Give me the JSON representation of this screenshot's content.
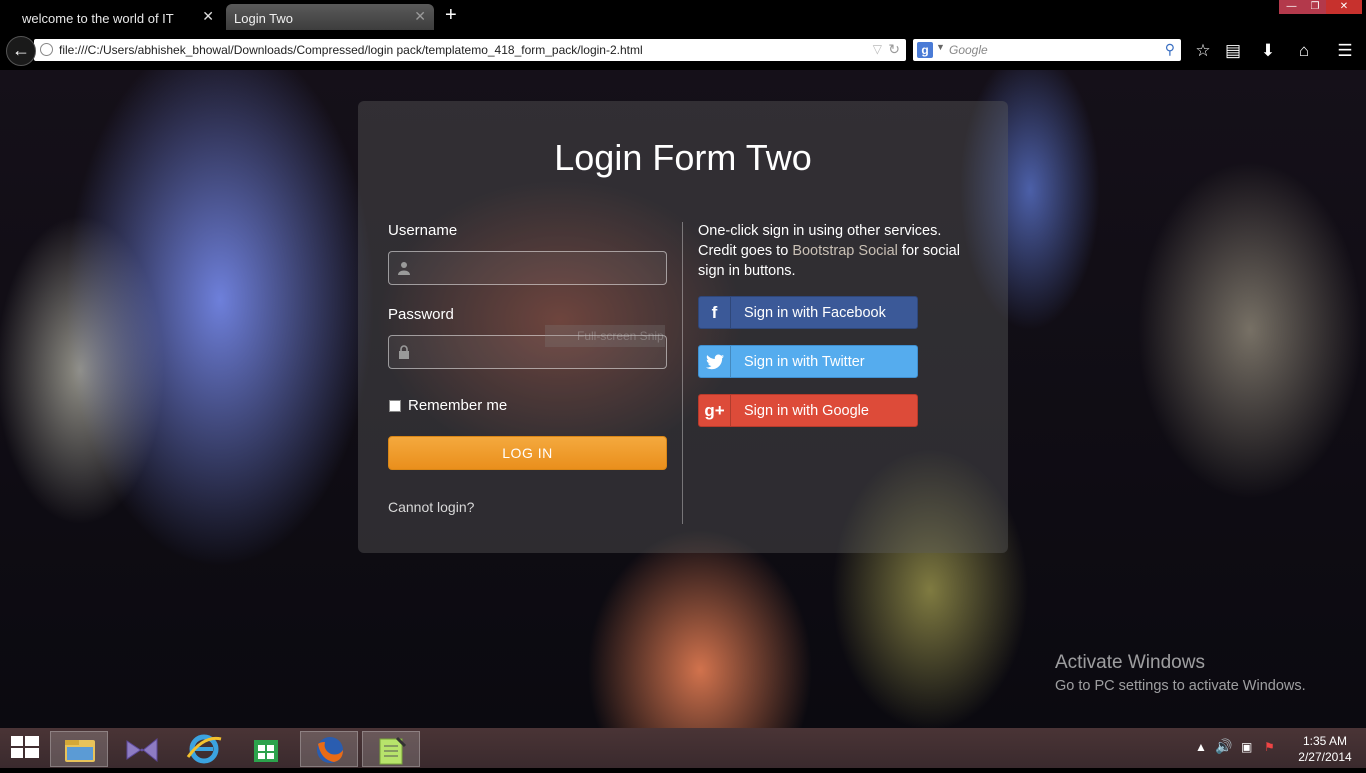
{
  "browser": {
    "tabs": [
      {
        "label": "welcome to the world of IT",
        "active": false
      },
      {
        "label": "Login Two",
        "active": true
      }
    ],
    "address": "file:///C:/Users/abhishek_bhowal/Downloads/Compressed/login pack/templatemo_418_form_pack/login-2.html",
    "search_placeholder": "Google",
    "search_engine_icon": "g",
    "new_tab_icon": "+"
  },
  "login": {
    "title": "Login Form Two",
    "username_label": "Username",
    "password_label": "Password",
    "username_value": "",
    "password_value": "",
    "remember_label": "Remember me",
    "login_button": "LOG IN",
    "cannot_login": "Cannot login?",
    "desc_1": "One-click sign in using other services. Credit goes to ",
    "desc_link": "Bootstrap Social",
    "desc_2": " for social sign in buttons.",
    "facebook": "Sign in with Facebook",
    "twitter": "Sign in with Twitter",
    "google": "Sign in with Google",
    "facebook_icon": "f",
    "google_icon": "g+"
  },
  "overlay": {
    "snip_text": "Full-screen Snip"
  },
  "watermark": {
    "line1": "Activate Windows",
    "line2": "Go to PC settings to activate Windows."
  },
  "taskbar": {
    "time": "1:35 AM",
    "date": "2/27/2014",
    "apps": [
      "file-explorer",
      "visual-studio",
      "internet-explorer",
      "windows-store",
      "firefox",
      "notepad-plus"
    ]
  },
  "colors": {
    "facebook": "#3b5998",
    "twitter": "#55acee",
    "google": "#dd4b39",
    "login_button": "#f0a030"
  }
}
